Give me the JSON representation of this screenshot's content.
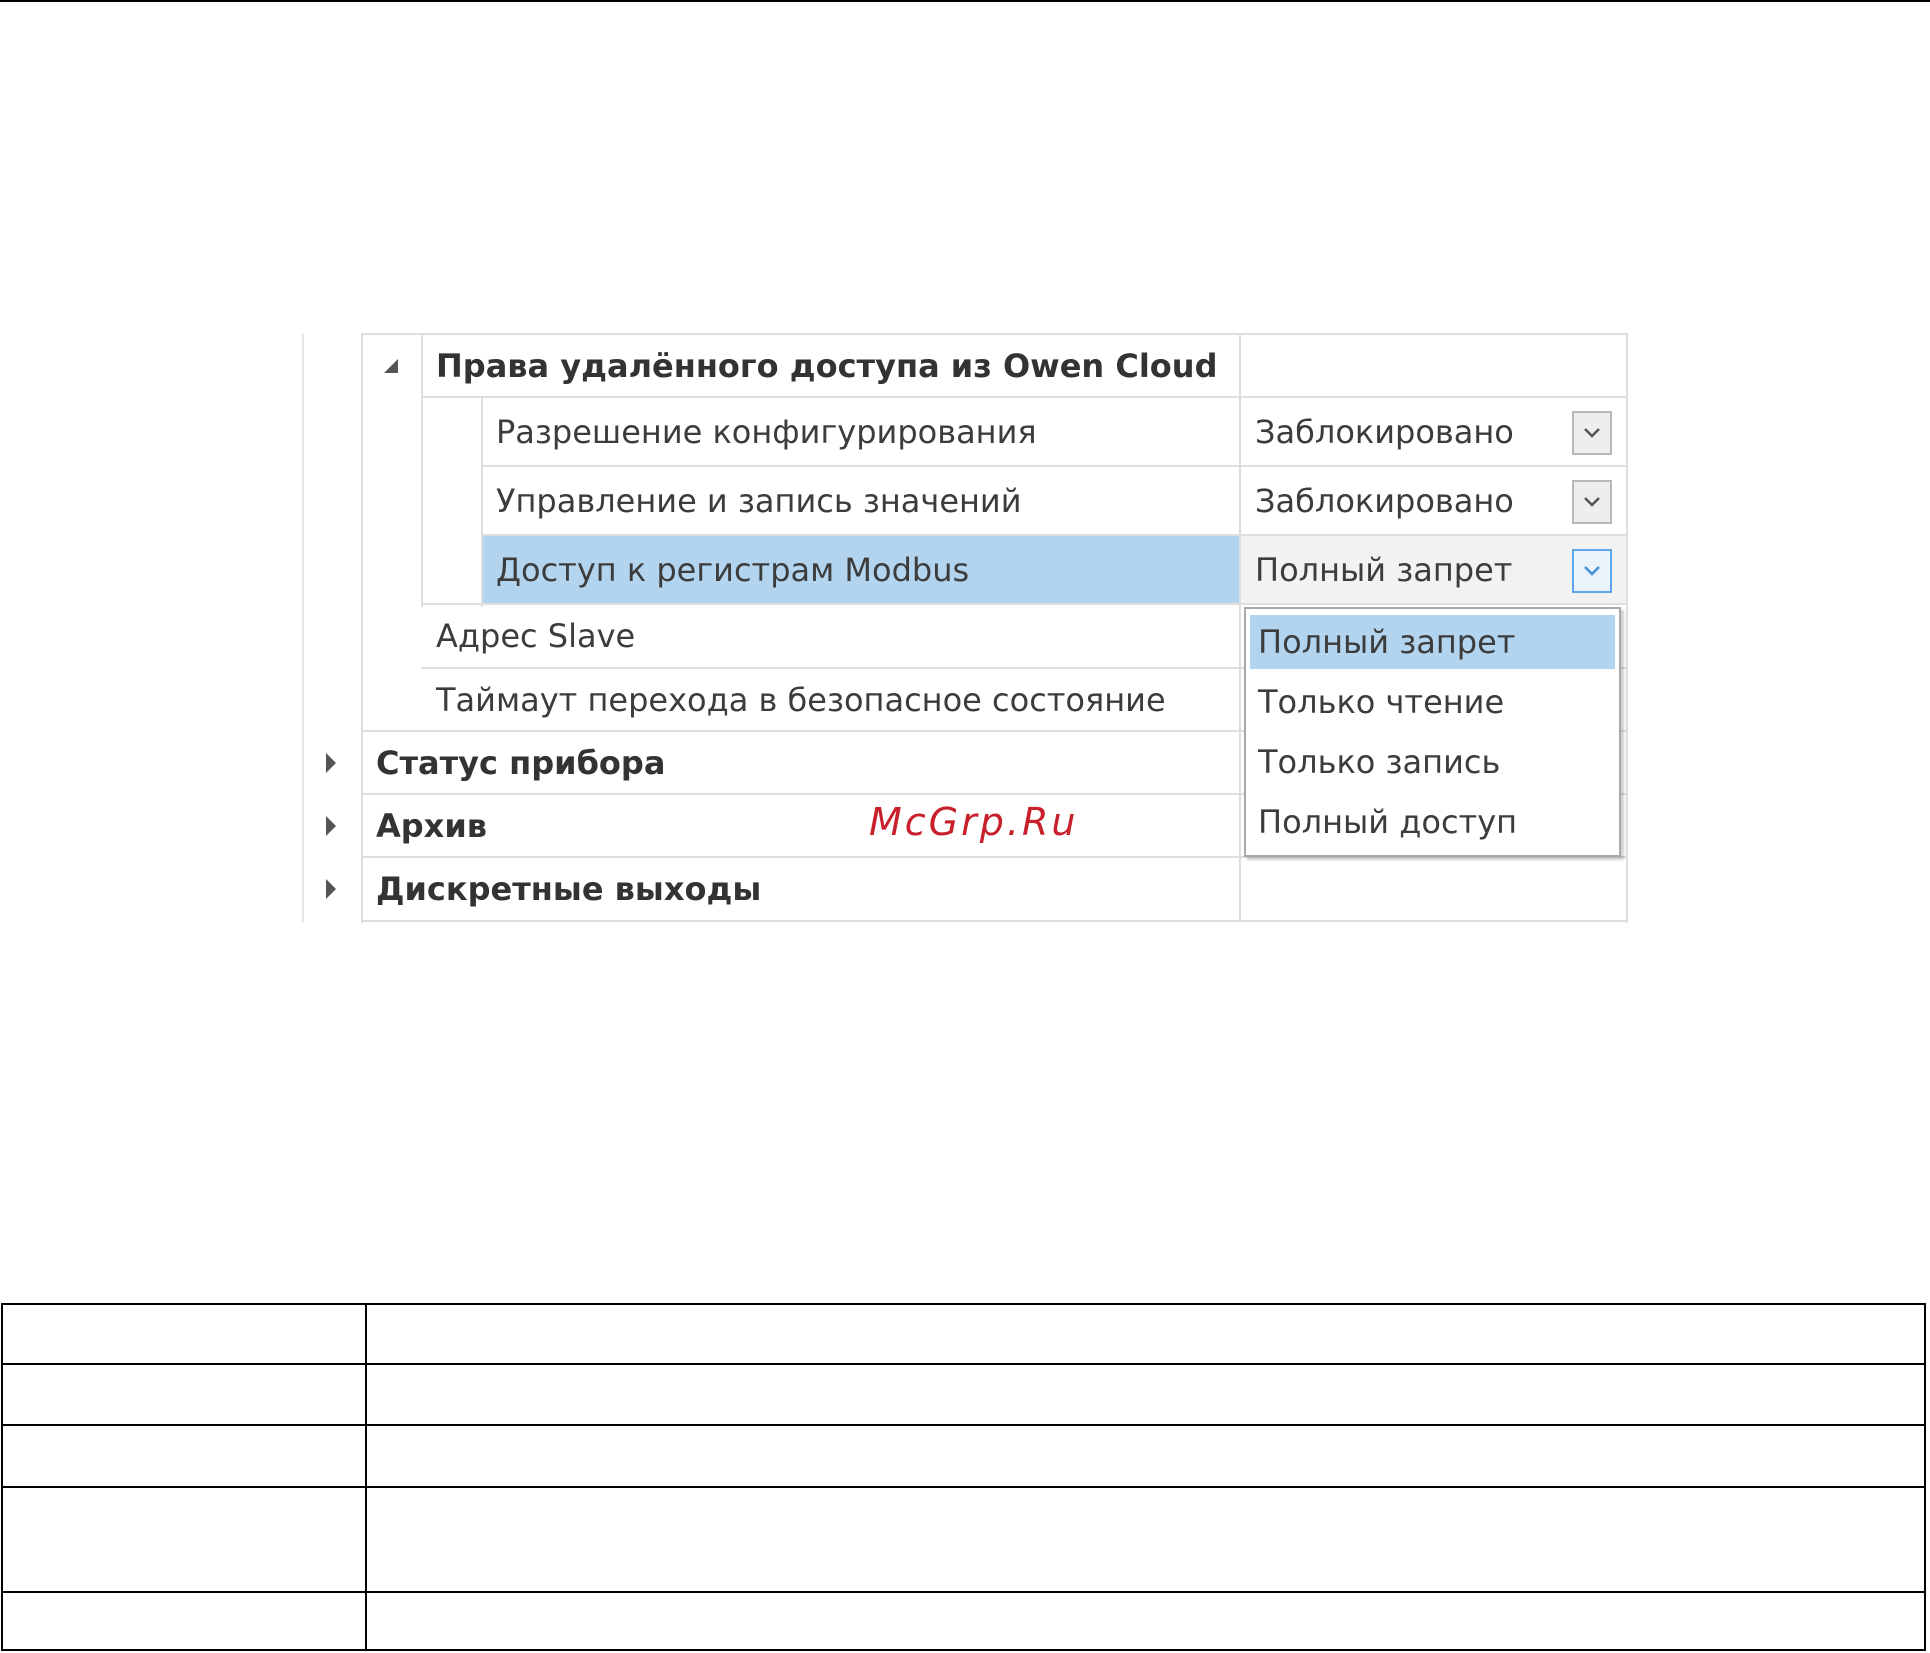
{
  "property_grid": {
    "group_remote": {
      "label": "Права удалённого доступа из Owen Cloud",
      "expanded": true,
      "children": [
        {
          "label": "Разрешение конфигурирования",
          "value": "Заблокировано"
        },
        {
          "label": "Управление и запись значений",
          "value": "Заблокировано"
        },
        {
          "label": "Доступ к регистрам Modbus",
          "value": "Полный запрет",
          "selected": true
        }
      ]
    },
    "rows": [
      {
        "label": "Адрес Slave"
      },
      {
        "label": "Таймаут перехода в безопасное состояние"
      }
    ],
    "collapsed_groups": [
      {
        "label": "Статус прибора"
      },
      {
        "label": "Архив"
      },
      {
        "label": "Дискретные выходы"
      }
    ],
    "dropdown": {
      "options": [
        "Полный запрет",
        "Только чтение",
        "Только запись",
        "Полный доступ"
      ],
      "highlighted_index": 0
    },
    "combo_icon": "chevron-down-icon",
    "selection_color": "#b3d4ef",
    "focus_color": "#5ea7e8"
  },
  "watermark": {
    "text": "McGrp.Ru",
    "color": "#c8202a"
  }
}
